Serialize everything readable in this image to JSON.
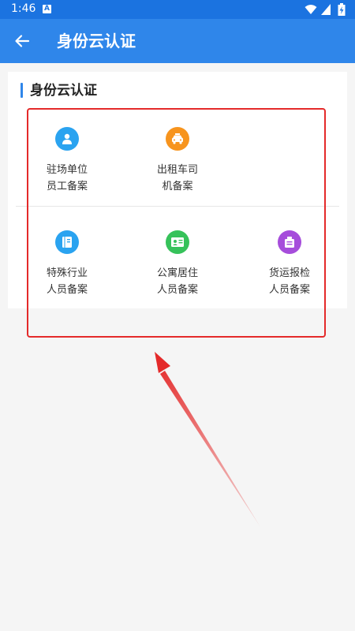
{
  "status_bar": {
    "time": "1:46",
    "notification_badge": "A",
    "icons": [
      "wifi-icon",
      "signal-icon",
      "battery-charging-icon"
    ]
  },
  "app_bar": {
    "title": "身份云认证",
    "back_icon": "arrow-left-icon",
    "color": "#2f86ea"
  },
  "section": {
    "title": "身份云认证"
  },
  "items": [
    {
      "line1": "驻场单位",
      "line2": "员工备案",
      "icon": "person-icon",
      "color": "#2aa3f0"
    },
    {
      "line1": "出租车司",
      "line2": "机备案",
      "icon": "taxi-icon",
      "color": "#f7941d"
    },
    {
      "line1": "特殊行业",
      "line2": "人员备案",
      "icon": "document-icon",
      "color": "#2aa3f0"
    },
    {
      "line1": "公寓居住",
      "line2": "人员备案",
      "icon": "id-card-icon",
      "color": "#36c25a"
    },
    {
      "line1": "货运报检",
      "line2": "人员备案",
      "icon": "cargo-icon",
      "color": "#a64ddb"
    }
  ],
  "annotation": {
    "color": "#e42a2a"
  }
}
